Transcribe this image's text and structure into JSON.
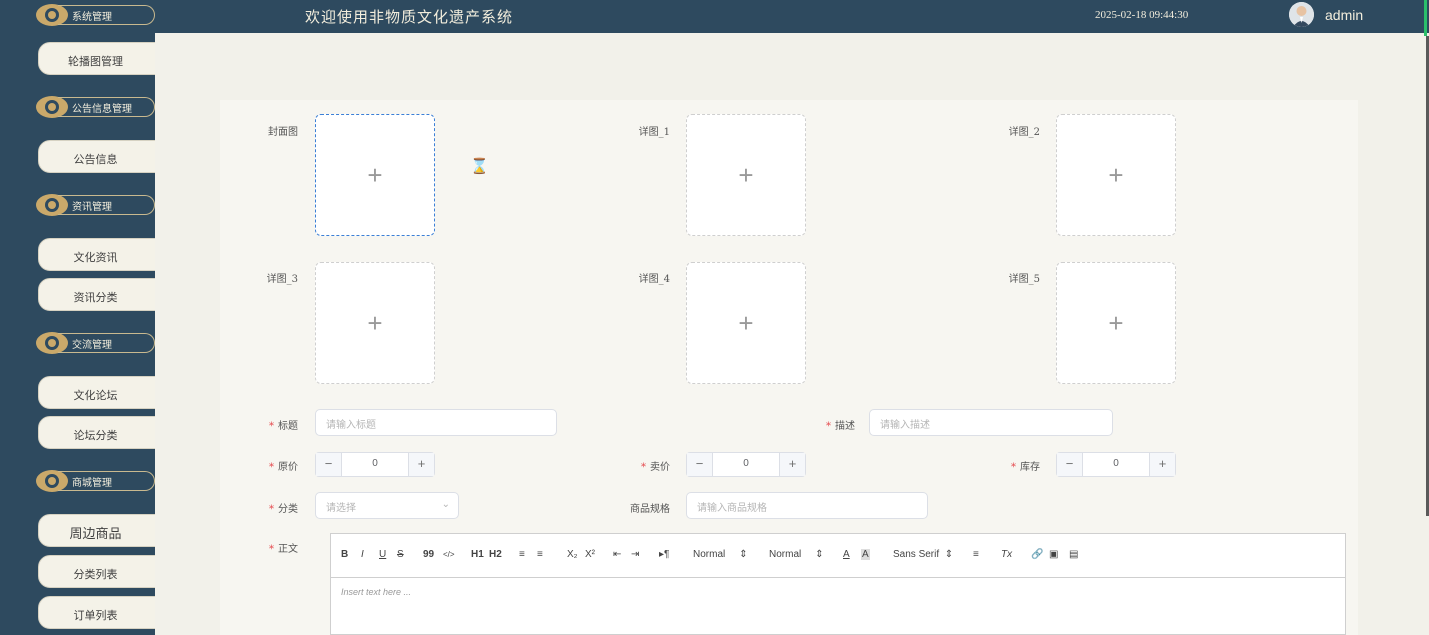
{
  "header": {
    "title": "欢迎使用非物质文化遗产系统",
    "datetime": "2025-02-18 09:44:30",
    "username": "admin"
  },
  "sidebar": {
    "groups": [
      {
        "label": "系统管理",
        "items": [
          "轮播图管理"
        ]
      },
      {
        "label": "公告信息管理",
        "items": [
          "公告信息"
        ]
      },
      {
        "label": "资讯管理",
        "items": [
          "文化资讯",
          "资讯分类"
        ]
      },
      {
        "label": "交流管理",
        "items": [
          "文化论坛",
          "论坛分类"
        ]
      },
      {
        "label": "商城管理",
        "items": [
          "周边商品",
          "分类列表",
          "订单列表"
        ]
      }
    ]
  },
  "form": {
    "cover_label": "封面图",
    "detail_labels": [
      "详图_1",
      "详图_2",
      "详图_3",
      "详图_4",
      "详图_5"
    ],
    "upload_plus": "+",
    "title_label": "标题",
    "title_placeholder": "请输入标题",
    "desc_label": "描述",
    "desc_placeholder": "请输入描述",
    "orig_price_label": "原价",
    "orig_price_value": "0",
    "sale_price_label": "卖价",
    "sale_price_value": "0",
    "stock_label": "库存",
    "stock_value": "0",
    "category_label": "分类",
    "category_placeholder": "请选择",
    "spec_label": "商品规格",
    "spec_placeholder": "请输入商品规格",
    "content_label": "正文",
    "required_mark": "*",
    "stepper_minus": "−",
    "stepper_plus": "+"
  },
  "editor": {
    "toolbar": {
      "bold": "B",
      "italic": "I",
      "underline": "U",
      "strike": "S",
      "blockquote": "99",
      "code": "</>",
      "h1": "H1",
      "h2": "H2",
      "ordered": "≡",
      "bullet": "≡",
      "sub": "X₂",
      "sup": "X²",
      "outdent": "⇤",
      "indent": "⇥",
      "direction": "▸¶",
      "size": "Normal",
      "header": "Normal",
      "font": "Sans Serif",
      "color": "A",
      "background": "A",
      "align": "≡",
      "clean": "Tx"
    },
    "placeholder": "Insert text here ..."
  },
  "colors": {
    "sidebar_bg": "#2e4a5f",
    "page_bg": "#f2f1ea",
    "required": "#e5484d",
    "active_border": "#3b7fd6"
  }
}
